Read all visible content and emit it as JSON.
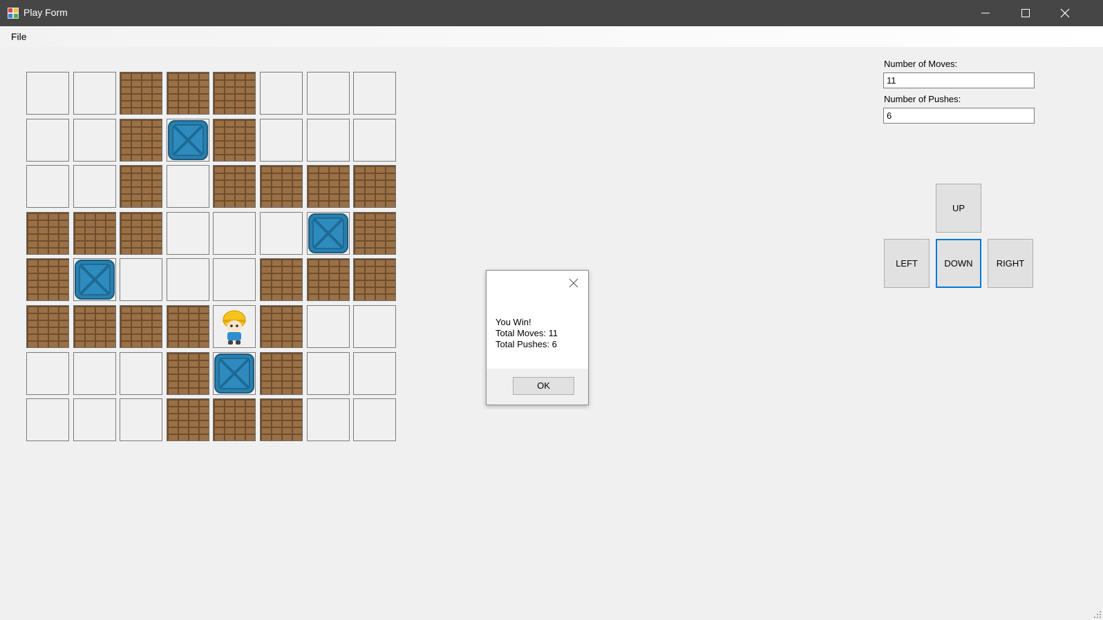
{
  "window": {
    "title": "Play Form"
  },
  "menu": {
    "items": [
      "File"
    ]
  },
  "stats": {
    "moves_label": "Number of Moves:",
    "moves_value": "11",
    "pushes_label": "Number of Pushes:",
    "pushes_value": "6"
  },
  "controls": {
    "up": "UP",
    "left": "LEFT",
    "down": "DOWN",
    "right": "RIGHT"
  },
  "board": {
    "rows": [
      "..WWW...",
      "..WBW...",
      "..W.WWWW",
      "WWW...BW",
      "WB...WWW",
      "WWWWPW..",
      "...WBW..",
      "...WWW.."
    ],
    "legend": {
      ".": "floor",
      "W": "wall",
      "B": "crate",
      "P": "player"
    }
  },
  "dialog": {
    "message": "You Win!\nTotal Moves: 11\nTotal Pushes: 6",
    "ok_label": "OK"
  },
  "colors": {
    "titlebar": "#464646",
    "wall": "#9a7046",
    "crate": "#2b7fad",
    "focus": "#0078d7"
  }
}
